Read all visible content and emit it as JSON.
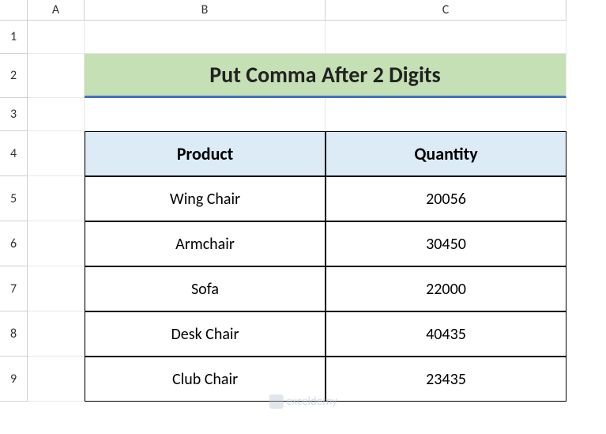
{
  "columns": [
    "A",
    "B",
    "C"
  ],
  "rows": [
    "1",
    "2",
    "3",
    "4",
    "5",
    "6",
    "7",
    "8",
    "9"
  ],
  "title": "Put Comma After 2 Digits",
  "headers": {
    "product": "Product",
    "quantity": "Quantity"
  },
  "chart_data": {
    "type": "table",
    "columns": [
      "Product",
      "Quantity"
    ],
    "rows": [
      {
        "product": "Wing Chair",
        "quantity": 20056
      },
      {
        "product": "Armchair",
        "quantity": 30450
      },
      {
        "product": "Sofa",
        "quantity": 22000
      },
      {
        "product": "Desk Chair",
        "quantity": 40435
      },
      {
        "product": "Club Chair",
        "quantity": 23435
      }
    ],
    "title": "Put Comma After 2 Digits"
  },
  "watermark": "exceldemy"
}
